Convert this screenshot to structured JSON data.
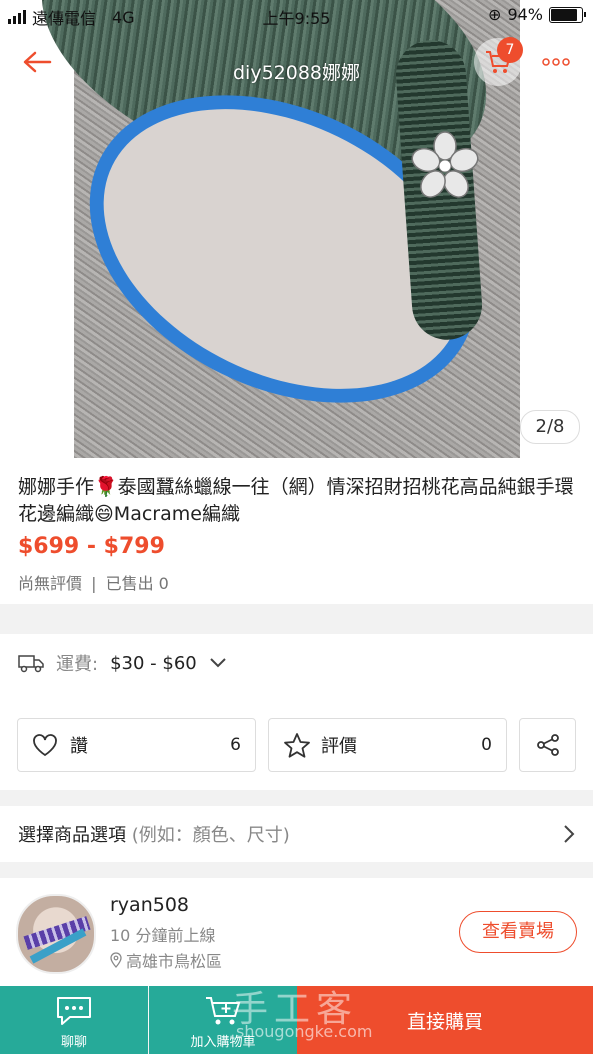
{
  "status_bar": {
    "carrier": "遠傳電信",
    "network": "4G",
    "time": "上午9:55",
    "battery": "94%"
  },
  "header": {
    "shop_name": "diy52088娜娜",
    "cart_count": "7"
  },
  "gallery": {
    "counter": "2/8"
  },
  "product": {
    "title": "娜娜手作🌹泰國蠶絲蠟線一往（網）情深招財招桃花高品純銀手環花邊編織😄Macrame編織",
    "price": "$699 - $799",
    "rating": "尚無評價",
    "sold": "已售出 0"
  },
  "shipping": {
    "label": "運費:",
    "value": "$30 - $60"
  },
  "actions": {
    "like_label": "讚",
    "like_count": "6",
    "review_label": "評價",
    "review_count": "0"
  },
  "option": {
    "label": "選擇商品選項",
    "hint": "(例如：顏色、尺寸)"
  },
  "seller": {
    "name": "ryan508",
    "online": "10 分鐘前上線",
    "location": "高雄市鳥松區",
    "view_shop": "查看賣場"
  },
  "bottom_bar": {
    "chat": "聊聊",
    "add_cart": "加入購物車",
    "buy": "直接購買"
  },
  "watermark": {
    "text": "手工客",
    "url": "shougongke.com"
  },
  "colors": {
    "accent": "#ee4d2d",
    "teal": "#26aa99"
  }
}
